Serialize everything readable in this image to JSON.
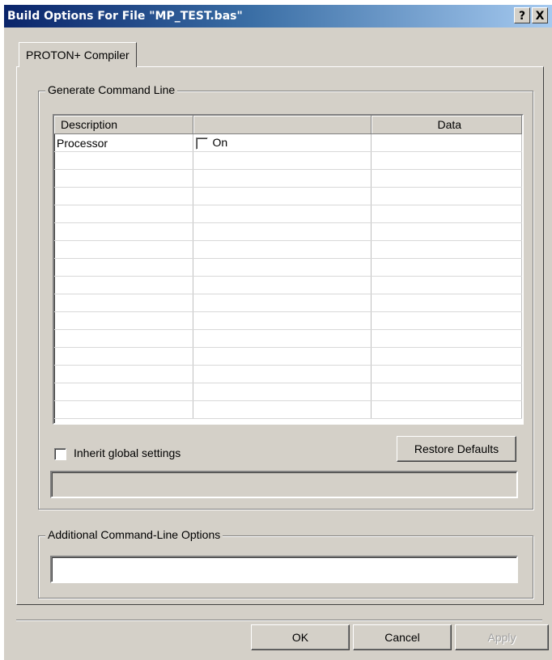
{
  "window": {
    "title": "Build Options For File \"MP_TEST.bas\"",
    "help_button": "?",
    "close_button": "X"
  },
  "tabs": [
    {
      "label": "PROTON+ Compiler",
      "selected": true
    }
  ],
  "generate_group": {
    "label": "Generate Command Line",
    "columns": [
      "Description",
      "",
      "Data"
    ],
    "rows": [
      {
        "description": "Processor",
        "checkbox_label": "On",
        "checked": false,
        "data": ""
      }
    ],
    "empty_rows": 15
  },
  "inherit": {
    "label": "Inherit global settings",
    "checked": false
  },
  "restore_defaults_label": "Restore Defaults",
  "command_line_preview": "",
  "additional_group": {
    "label": "Additional Command-Line Options",
    "value": ""
  },
  "buttons": {
    "ok": "OK",
    "cancel": "Cancel",
    "apply": "Apply"
  }
}
